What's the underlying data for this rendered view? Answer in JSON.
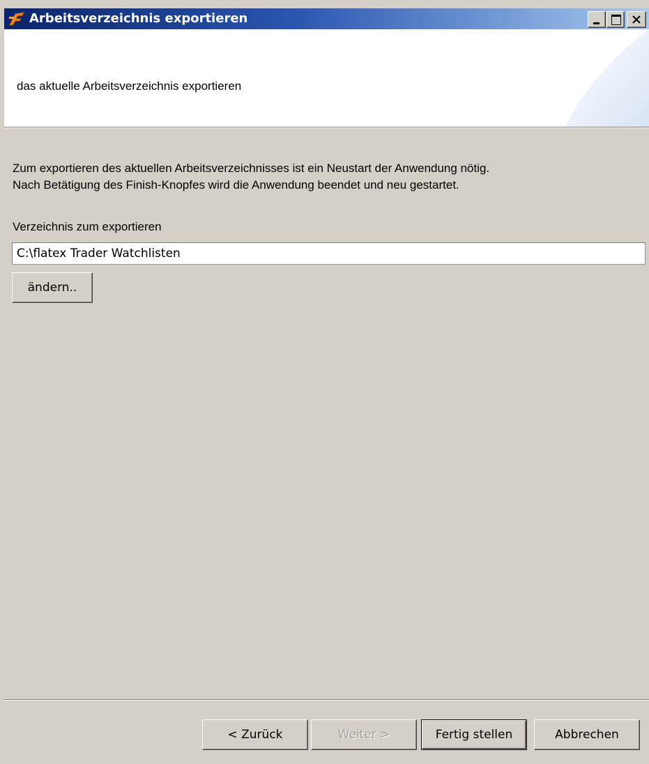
{
  "window": {
    "title": "Arbeitsverzeichnis exportieren",
    "accent": "#0a246a",
    "icon": "app-logo-icon"
  },
  "header": {
    "description": "das aktuelle Arbeitsverzeichnis exportieren"
  },
  "body": {
    "intro_line1": "Zum exportieren des aktuellen Arbeitsverzeichnisses ist ein Neustart der Anwendung nötig.",
    "intro_line2": "Nach Betätigung des Finish-Knopfes wird die Anwendung beendet und neu gestartet.",
    "directory_label": "Verzeichnis zum exportieren",
    "directory_value": "C:\\flatex Trader Watchlisten",
    "change_label": "ändern.."
  },
  "footer": {
    "back_label": "< Zurück",
    "next_label": "Weiter >",
    "finish_label": "Fertig stellen",
    "cancel_label": "Abbrechen"
  }
}
